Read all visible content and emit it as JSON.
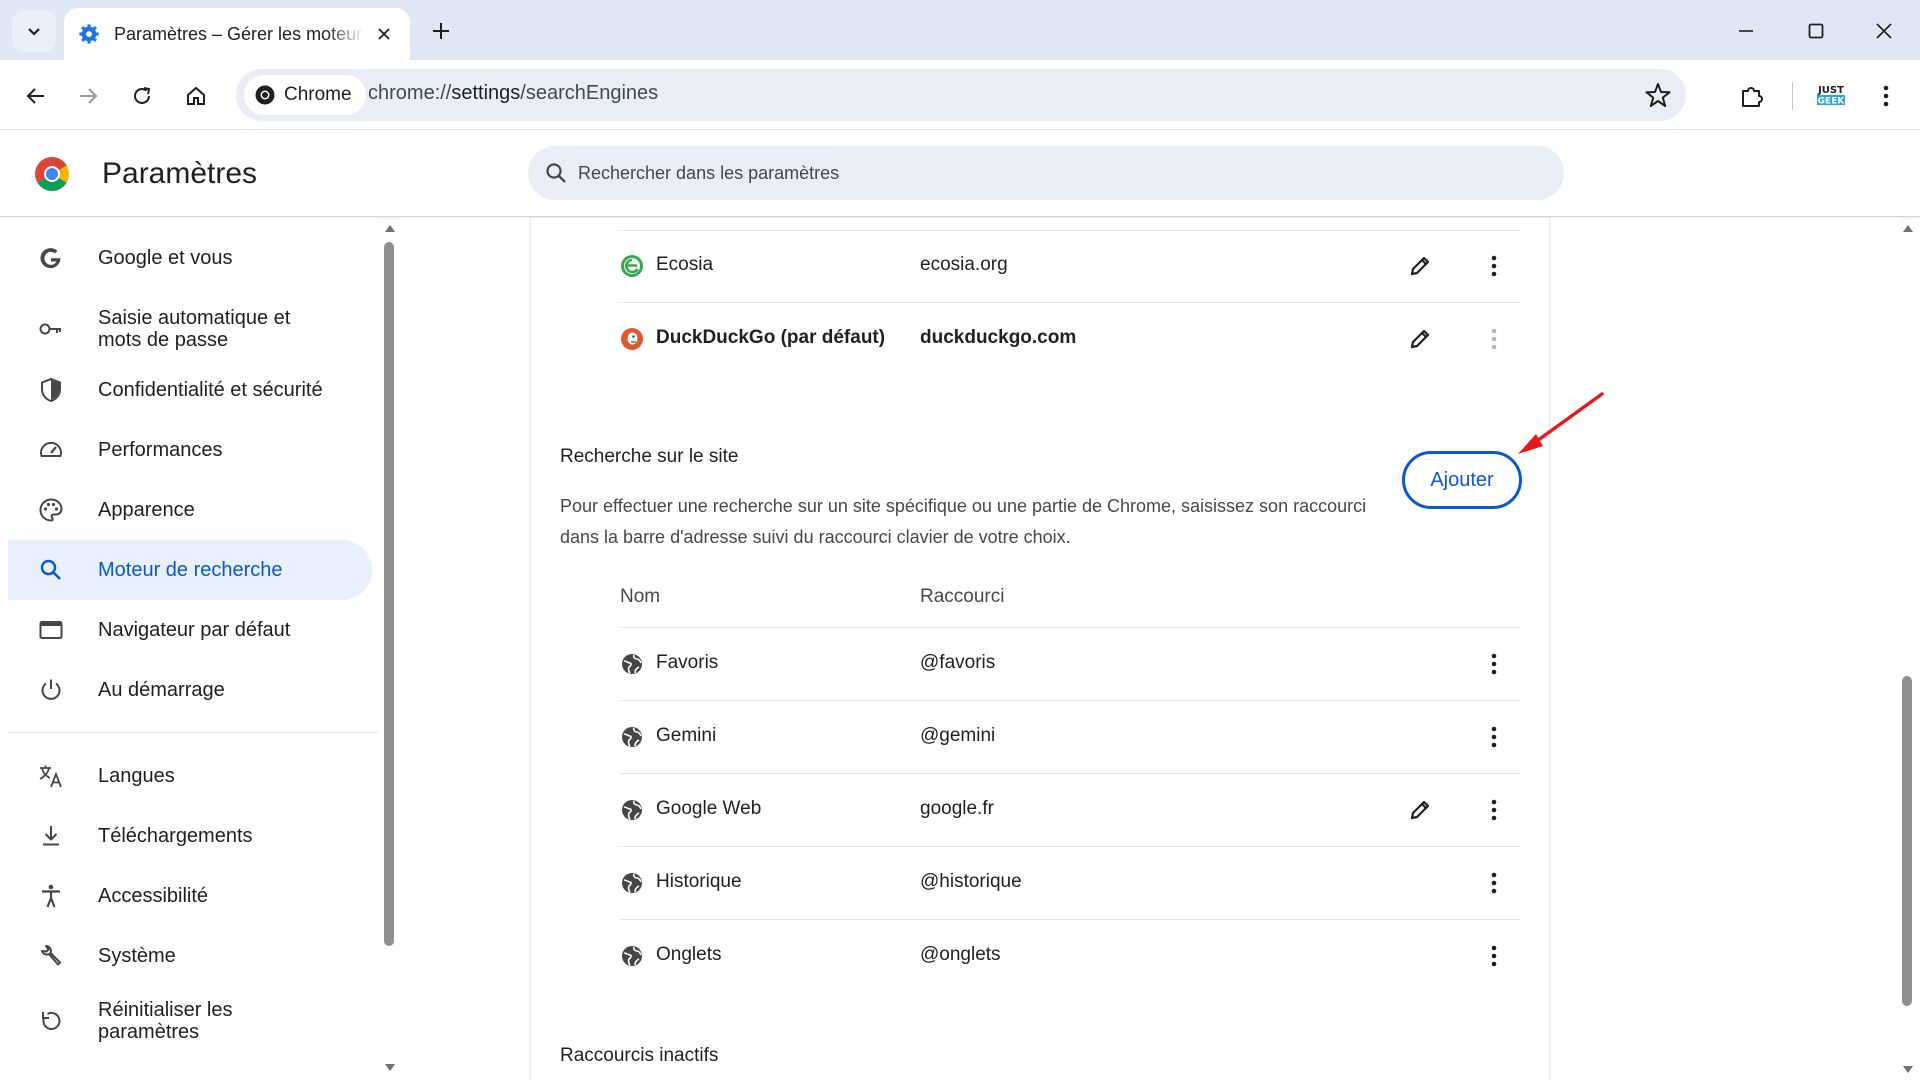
{
  "browser": {
    "tab_title": "Paramètres – Gérer les moteurs de recherche et la recherche sur le site",
    "chip_label": "Chrome",
    "url_prefix": "chrome://",
    "url_main": "settings",
    "url_suffix": "/searchEngines"
  },
  "header": {
    "title": "Paramètres",
    "search_placeholder": "Rechercher dans les paramètres"
  },
  "sidebar": {
    "items": [
      {
        "label": "Google et vous",
        "icon": "google-g-icon"
      },
      {
        "label": "Saisie automatique et",
        "label2": "mots de passe",
        "icon": "key-icon"
      },
      {
        "label": "Confidentialité et sécurité",
        "icon": "shield-icon"
      },
      {
        "label": "Performances",
        "icon": "speedometer-icon"
      },
      {
        "label": "Apparence",
        "icon": "palette-icon"
      },
      {
        "label": "Moteur de recherche",
        "icon": "search-icon",
        "active": true
      },
      {
        "label": "Navigateur par défaut",
        "icon": "browser-window-icon"
      },
      {
        "label": "Au démarrage",
        "icon": "power-icon"
      },
      {
        "label": "Langues",
        "icon": "translate-icon"
      },
      {
        "label": "Téléchargements",
        "icon": "download-icon"
      },
      {
        "label": "Accessibilité",
        "icon": "accessibility-icon"
      },
      {
        "label": "Système",
        "icon": "wrench-icon"
      },
      {
        "label": "Réinitialiser les",
        "label2": "paramètres",
        "icon": "reset-icon"
      }
    ]
  },
  "engines": [
    {
      "name": "Ecosia",
      "shortcut": "ecosia.org",
      "icon": "ecosia-icon"
    },
    {
      "name": "DuckDuckGo (par défaut)",
      "shortcut": "duckduckgo.com",
      "icon": "duckduckgo-icon"
    }
  ],
  "site_search": {
    "title": "Recherche sur le site",
    "description": "Pour effectuer une recherche sur un site spécifique ou une partie de Chrome, saisissez son raccourci dans la barre d'adresse suivi du raccourci clavier de votre choix.",
    "add_label": "Ajouter",
    "col_name": "Nom",
    "col_shortcut": "Raccourci",
    "rows": [
      {
        "name": "Favoris",
        "shortcut": "@favoris"
      },
      {
        "name": "Gemini",
        "shortcut": "@gemini"
      },
      {
        "name": "Google Web",
        "shortcut": "google.fr"
      },
      {
        "name": "Historique",
        "shortcut": "@historique"
      },
      {
        "name": "Onglets",
        "shortcut": "@onglets"
      }
    ]
  },
  "inactive": {
    "title": "Raccourcis inactifs"
  },
  "colors": {
    "accent": "#0b57d0",
    "active_bg": "#e8f0fe",
    "annotation_arrow": "#e8191c"
  }
}
